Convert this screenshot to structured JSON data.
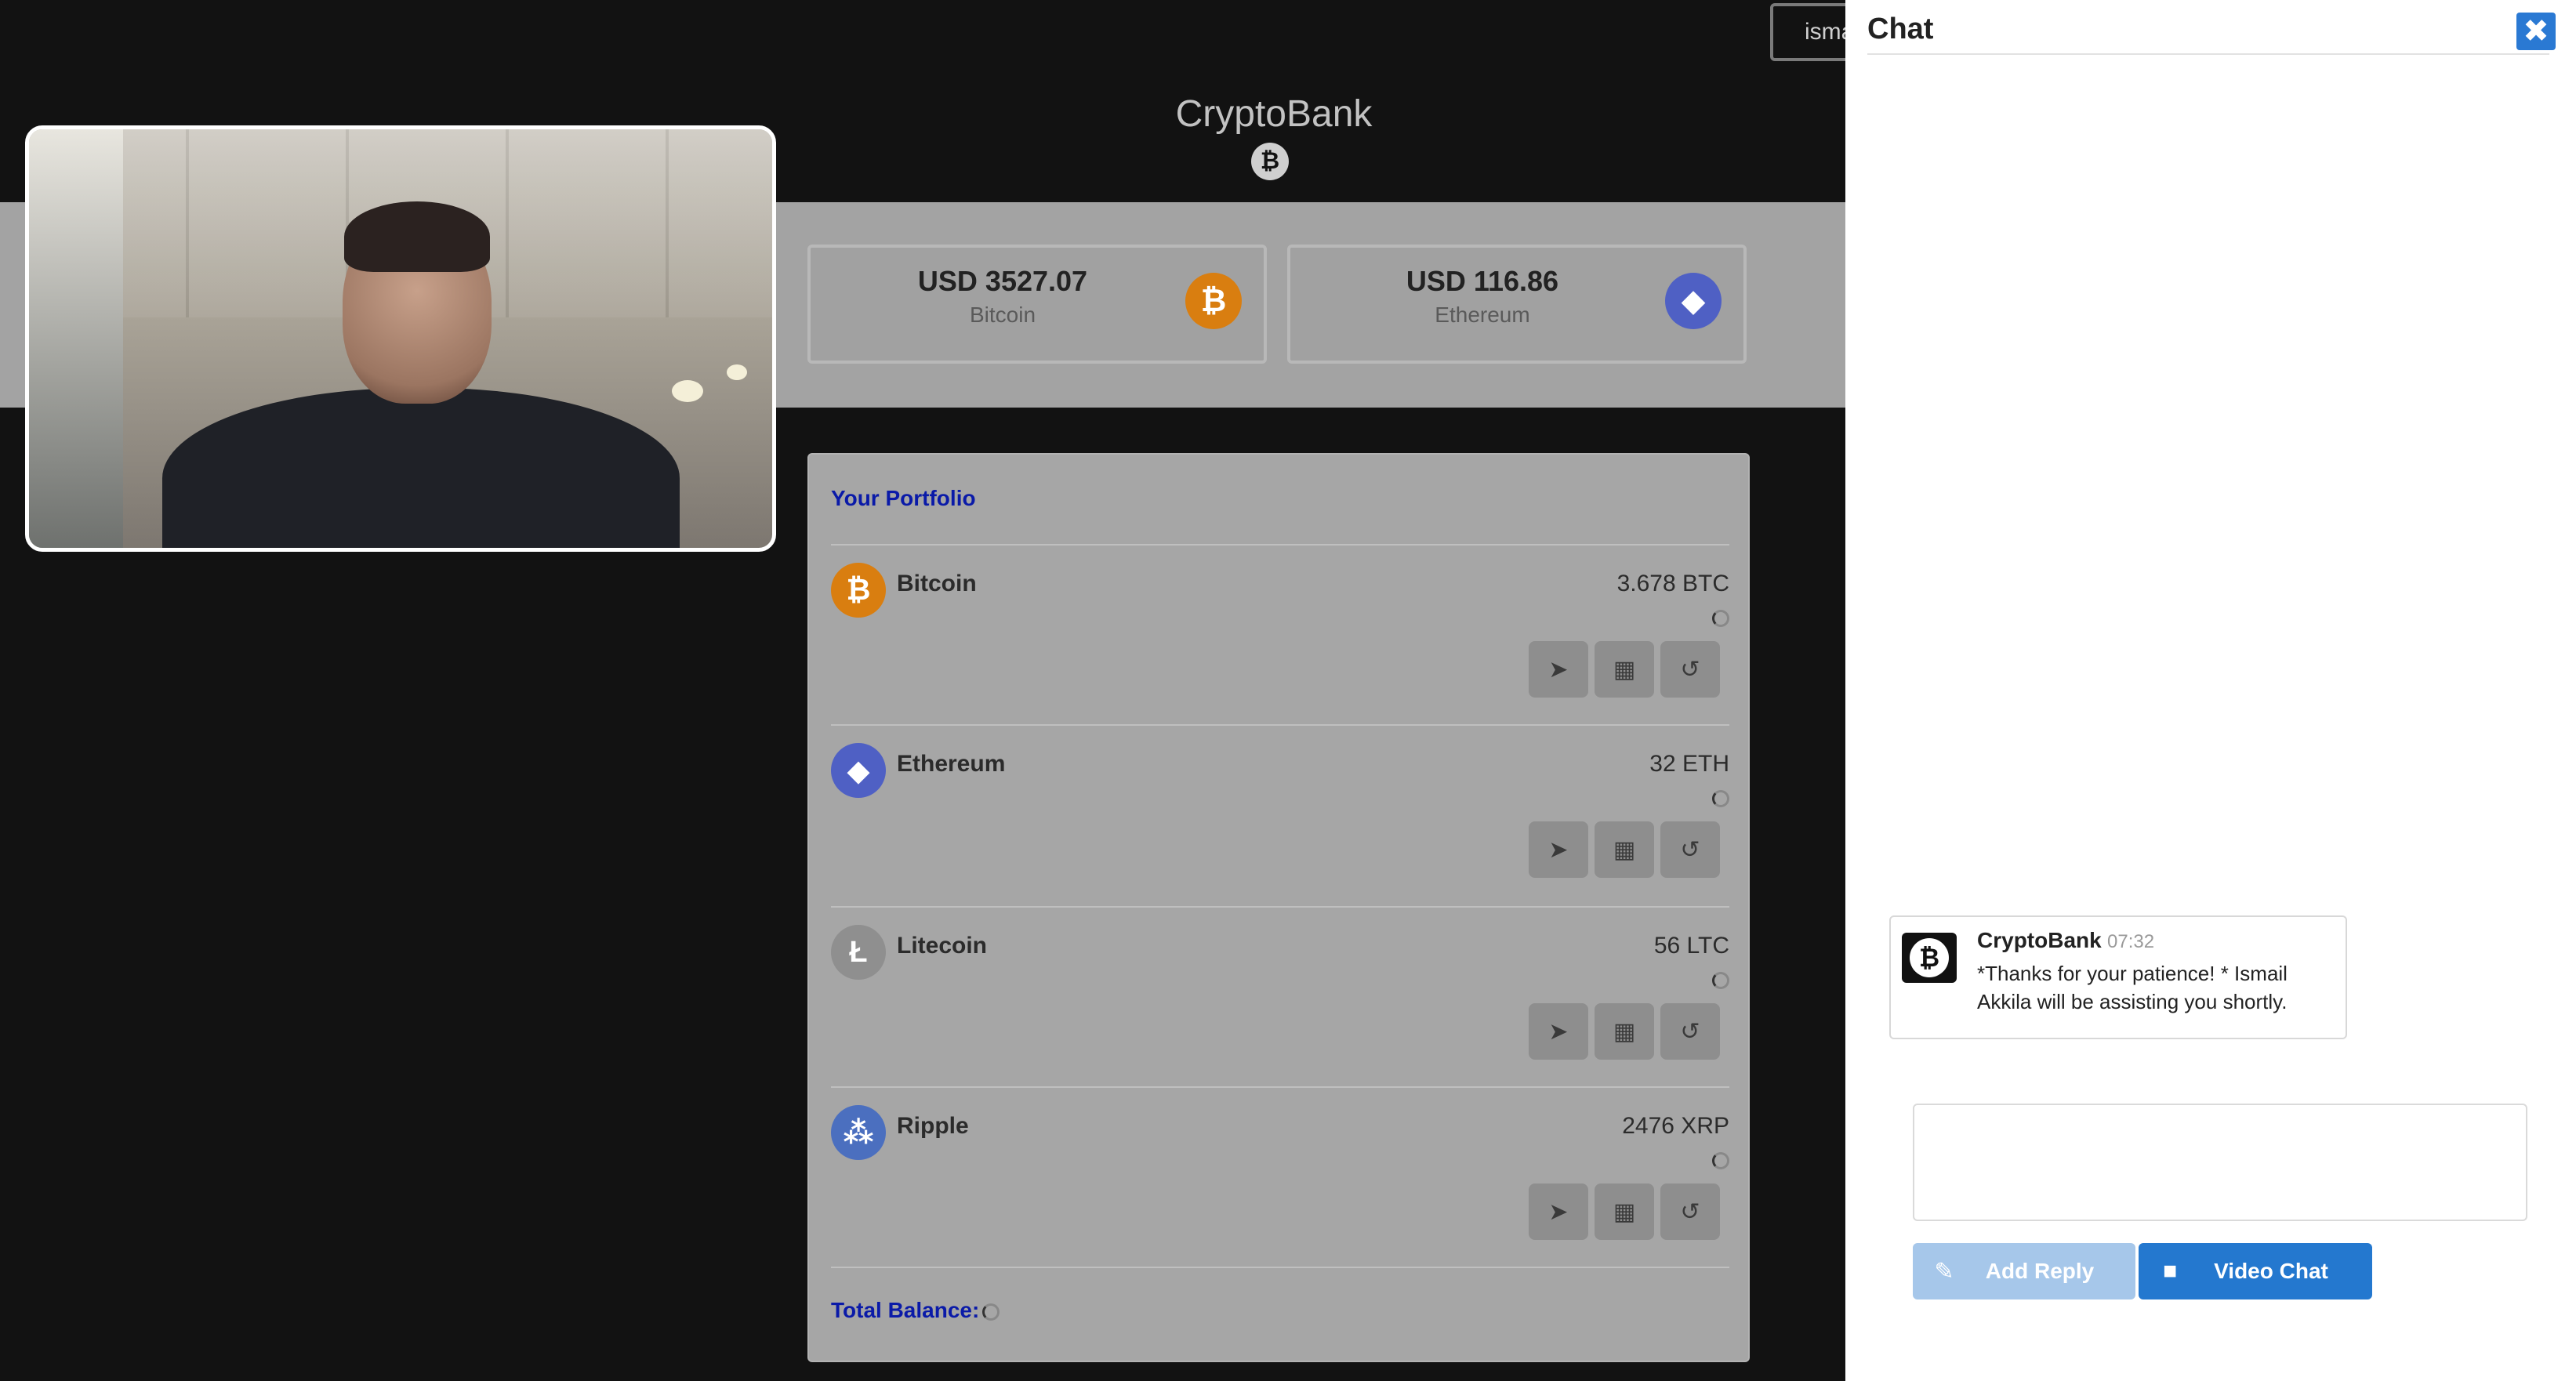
{
  "header": {
    "user_label": "isma",
    "brand_title": "CryptoBank",
    "brand_logo_glyph": "₿"
  },
  "prices": [
    {
      "amount": "USD 3527.07",
      "coin": "Bitcoin",
      "icon": "bitcoin-icon",
      "glyph": "₿",
      "color": "#d97e10"
    },
    {
      "amount": "USD 116.86",
      "coin": "Ethereum",
      "icon": "ethereum-icon",
      "glyph": "◆",
      "color": "#4f60c4"
    }
  ],
  "portfolio": {
    "title": "Your Portfolio",
    "total_label": "Total Balance:",
    "assets": [
      {
        "name": "Bitcoin",
        "qty": "3.678 BTC",
        "glyph": "₿",
        "icon": "bitcoin-icon"
      },
      {
        "name": "Ethereum",
        "qty": "32 ETH",
        "glyph": "◆",
        "icon": "ethereum-icon"
      },
      {
        "name": "Litecoin",
        "qty": "56 LTC",
        "glyph": "Ł",
        "icon": "litecoin-icon"
      },
      {
        "name": "Ripple",
        "qty": "2476 XRP",
        "glyph": "⁂",
        "icon": "ripple-icon"
      }
    ],
    "actions": [
      {
        "glyph": "➤",
        "icon": "send-icon"
      },
      {
        "glyph": "▦",
        "icon": "qr-code-icon"
      },
      {
        "glyph": "↺",
        "icon": "history-icon"
      }
    ]
  },
  "chat": {
    "title": "Chat",
    "close_glyph": "✖",
    "message": {
      "sender": "CryptoBank",
      "time": "07:32",
      "text": "*Thanks for your patience! * Ismail Akkila will be assisting you shortly.",
      "avatar_glyph": "₿"
    },
    "reply_placeholder": "",
    "add_reply_label": "Add Reply",
    "add_reply_glyph": "✎",
    "video_chat_label": "Video Chat",
    "video_chat_glyph": "■"
  }
}
